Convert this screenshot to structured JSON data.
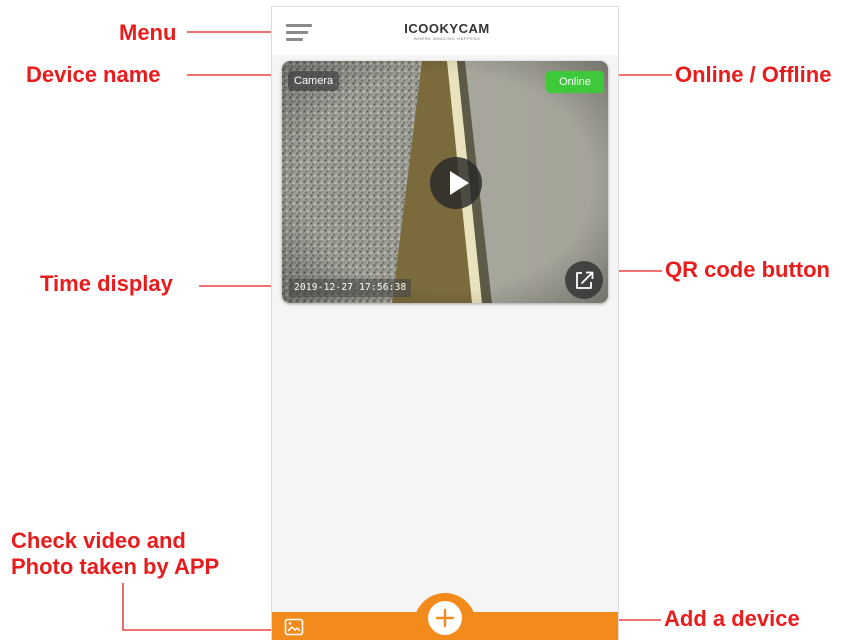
{
  "header": {
    "brand_name": "ICOOKYCAM",
    "brand_tagline": "WHERE AMAZING HAPPENS"
  },
  "camera": {
    "device_name": "Camera",
    "status": "Online",
    "timestamp": "2019-12-27  17:56:38"
  },
  "callouts": {
    "menu": "Menu",
    "device_name": "Device name",
    "online_offline": "Online / Offline",
    "time_display": "Time display",
    "qr_code_button": "QR code button",
    "check_video_line1": "Check video and",
    "check_video_line2": "Photo taken by APP",
    "add_device": "Add a device"
  },
  "icons": {
    "menu": "hamburger-menu-icon",
    "play": "play-icon",
    "qr": "share-export-icon",
    "gallery": "image-gallery-icon",
    "add": "plus-icon"
  },
  "colors": {
    "accent_orange": "#f28a1c",
    "online_green": "#3ec93b",
    "callout_red": "#e81c1c"
  }
}
